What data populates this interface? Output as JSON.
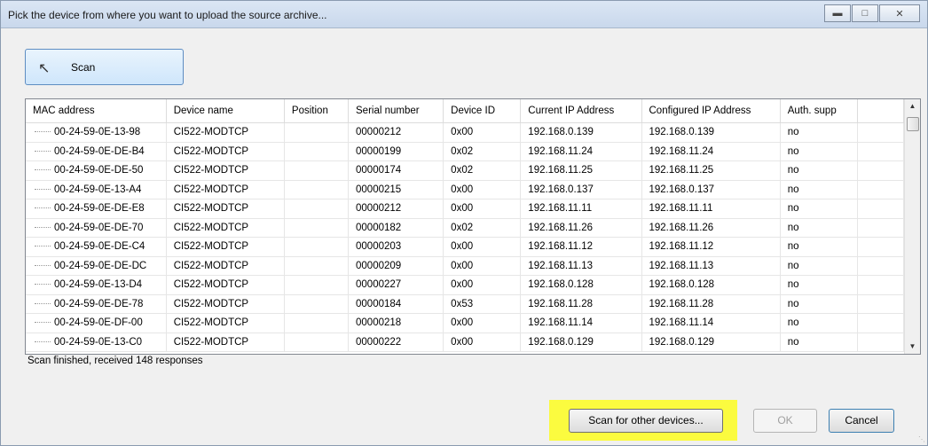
{
  "window": {
    "title": "Pick the device from where you want to upload the source archive..."
  },
  "scan_button": {
    "label": "Scan",
    "icon": "cursor-arrow-icon"
  },
  "table": {
    "columns": [
      "MAC address",
      "Device name",
      "Position",
      "Serial number",
      "Device ID",
      "Current IP Address",
      "Configured IP Address",
      "Auth. supp"
    ],
    "rows": [
      [
        "00-24-59-0E-13-98",
        "CI522-MODTCP",
        "",
        "00000212",
        "0x00",
        "192.168.0.139",
        "192.168.0.139",
        "no"
      ],
      [
        "00-24-59-0E-DE-B4",
        "CI522-MODTCP",
        "",
        "00000199",
        "0x02",
        "192.168.11.24",
        "192.168.11.24",
        "no"
      ],
      [
        "00-24-59-0E-DE-50",
        "CI522-MODTCP",
        "",
        "00000174",
        "0x02",
        "192.168.11.25",
        "192.168.11.25",
        "no"
      ],
      [
        "00-24-59-0E-13-A4",
        "CI522-MODTCP",
        "",
        "00000215",
        "0x00",
        "192.168.0.137",
        "192.168.0.137",
        "no"
      ],
      [
        "00-24-59-0E-DE-E8",
        "CI522-MODTCP",
        "",
        "00000212",
        "0x00",
        "192.168.11.11",
        "192.168.11.11",
        "no"
      ],
      [
        "00-24-59-0E-DE-70",
        "CI522-MODTCP",
        "",
        "00000182",
        "0x02",
        "192.168.11.26",
        "192.168.11.26",
        "no"
      ],
      [
        "00-24-59-0E-DE-C4",
        "CI522-MODTCP",
        "",
        "00000203",
        "0x00",
        "192.168.11.12",
        "192.168.11.12",
        "no"
      ],
      [
        "00-24-59-0E-DE-DC",
        "CI522-MODTCP",
        "",
        "00000209",
        "0x00",
        "192.168.11.13",
        "192.168.11.13",
        "no"
      ],
      [
        "00-24-59-0E-13-D4",
        "CI522-MODTCP",
        "",
        "00000227",
        "0x00",
        "192.168.0.128",
        "192.168.0.128",
        "no"
      ],
      [
        "00-24-59-0E-DE-78",
        "CI522-MODTCP",
        "",
        "00000184",
        "0x53",
        "192.168.11.28",
        "192.168.11.28",
        "no"
      ],
      [
        "00-24-59-0E-DF-00",
        "CI522-MODTCP",
        "",
        "00000218",
        "0x00",
        "192.168.11.14",
        "192.168.11.14",
        "no"
      ],
      [
        "00-24-59-0E-13-C0",
        "CI522-MODTCP",
        "",
        "00000222",
        "0x00",
        "192.168.0.129",
        "192.168.0.129",
        "no"
      ]
    ]
  },
  "status_text": "Scan finished, received 148 responses",
  "buttons": {
    "scan_other": "Scan for other devices...",
    "ok": "OK",
    "cancel": "Cancel"
  },
  "colors": {
    "highlight": "#fbfb3f",
    "scan_button": "#cfe6fb"
  }
}
